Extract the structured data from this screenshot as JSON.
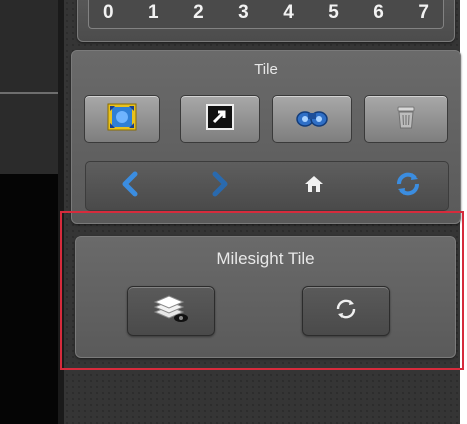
{
  "presets": {
    "numbers": [
      "0",
      "1",
      "2",
      "3",
      "4",
      "5",
      "6",
      "7"
    ]
  },
  "tile_panel": {
    "title": "Tile",
    "buttons": [
      {
        "icon": "fit-screen-icon"
      },
      {
        "icon": "popout-window-icon"
      },
      {
        "icon": "binoculars-icon"
      },
      {
        "icon": "trash-icon"
      }
    ],
    "nav": [
      {
        "icon": "chevron-left-icon"
      },
      {
        "icon": "chevron-right-icon"
      },
      {
        "icon": "home-icon"
      },
      {
        "icon": "refresh-icon"
      }
    ]
  },
  "milesight_tile": {
    "title": "Milesight Tile",
    "buttons": [
      {
        "icon": "layers-view-icon"
      },
      {
        "icon": "loop-icon"
      }
    ]
  },
  "colors": {
    "highlight_border": "#d62b3c",
    "icon_blue": "#2f7fd6",
    "panel_gray": "#5f5f5f"
  }
}
